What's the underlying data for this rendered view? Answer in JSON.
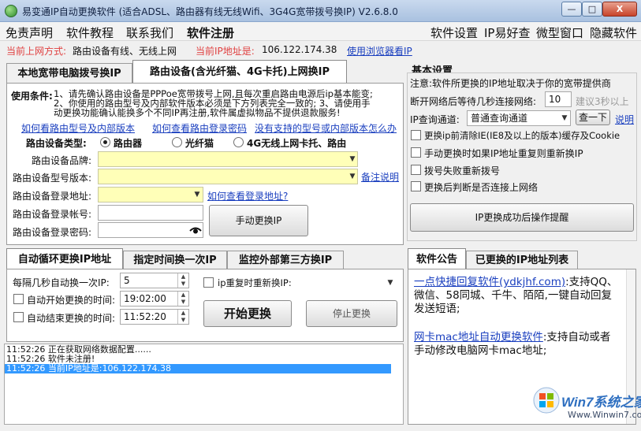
{
  "window": {
    "title": "易变通IP自动更换软件 (适合ADSL、路由器有线无线Wifi、3G4G宽带拨号换IP) V2.6.8.0",
    "min": "—",
    "max": "□",
    "close": "X"
  },
  "menu": {
    "left": [
      "免责声明",
      "软件教程",
      "联系我们",
      "软件注册"
    ],
    "right": [
      "软件设置",
      "IP易好查",
      "微型窗口",
      "隐藏软件"
    ]
  },
  "info": {
    "mode_label": "当前上网方式:",
    "mode_value": "路由设备有线、无线上网",
    "ip_label": "当前IP地址是:",
    "ip_value": "106.122.174.38",
    "browser_link": "使用浏览器看IP"
  },
  "top_tabs": [
    "本地宽带电脑拨号换IP",
    "路由设备(含光纤猫、4G卡托)上网换IP"
  ],
  "router": {
    "conditions_label": "使用条件:",
    "conditions_text": [
      "1、请先确认路由设备是PPPoe宽带拨号上网,且每次重启路由电源后ip基本能变;",
      "2、你使用的路由型号及内部软件版本必须是下方列表完全一致的; 3、请使用手",
      "动更换功能确认能换多个不同IP再注册,软件属虚拟物品不提供退款服务!"
    ],
    "links": [
      "如何看路由型号及内部版本",
      "如何查看路由登录密码",
      "没有支持的型号或内部版本怎么办"
    ],
    "type_label": "路由设备类型:",
    "types": [
      "路由器",
      "光纤猫",
      "4G无线上网卡托、路由"
    ],
    "brand_label": "路由设备品牌:",
    "model_label": "路由设备型号版本:",
    "address_label": "路由设备登录地址:",
    "address_link": "如何查看登录地址?",
    "user_label": "路由设备登录帐号:",
    "pass_label": "路由设备登录密码:",
    "remark_link": "备注说明",
    "manual_button": "手动更换IP"
  },
  "basic": {
    "title": "基本设置",
    "note": "注意:软件所更换的IP地址取决于你的宽带提供商",
    "wait_label": "断开网络后等待几秒连接网络:",
    "wait_value": "10",
    "wait_hint": "建议3秒以上",
    "channel_label": "IP查询通道:",
    "channel_value": "普通查询通道",
    "check_button": "查一下",
    "explain_link": "说明",
    "options": [
      "更换ip前清除IE(IE8及以上的版本)缓存及Cookie",
      "手动更换时如果IP地址重复则重新换IP",
      "拨号失败重新拨号",
      "更换后判断是否连接上网络"
    ],
    "remind_button": "IP更换成功后操作提醒"
  },
  "bottom_tabs": [
    "自动循环更换IP地址",
    "指定时间换一次IP",
    "监控外部第三方换IP"
  ],
  "auto": {
    "interval_label": "每隔几秒自动换一次IP:",
    "interval_value": "5",
    "start_label": "自动开始更换的时间:",
    "start_value": "19:02:00",
    "end_label": "自动结束更换的时间:",
    "end_value": "11:52:20",
    "repeat_label": "ip重复时重新换IP:",
    "start_button": "开始更换",
    "stop_button": "停止更换"
  },
  "log": [
    "11:52:26 正在获取网络数据配置......",
    "11:52:26 软件未注册!",
    "11:52:26 当前IP地址是:106.122.174.38"
  ],
  "notice_tabs": [
    "软件公告",
    "已更换的IP地址列表"
  ],
  "notice": {
    "item1_link": "一点快捷回复软件(ydkjhf.com)",
    "item1_rest": ":支持QQ、微信、58同城、千牛、陌陌,一键自动回复发送短语;",
    "item2_link": "网卡mac地址自动更换软件",
    "item2_rest": ":支持自动或者手动修改电脑网卡mac地址;"
  },
  "watermark": {
    "brand": "Win7系统之家",
    "url": "Www.Winwin7.com"
  },
  "colors": {
    "accent_red": "#e04040",
    "link_blue": "#1a3fbf",
    "selection_blue": "#3399ff",
    "input_yellow": "#ffffb8"
  }
}
